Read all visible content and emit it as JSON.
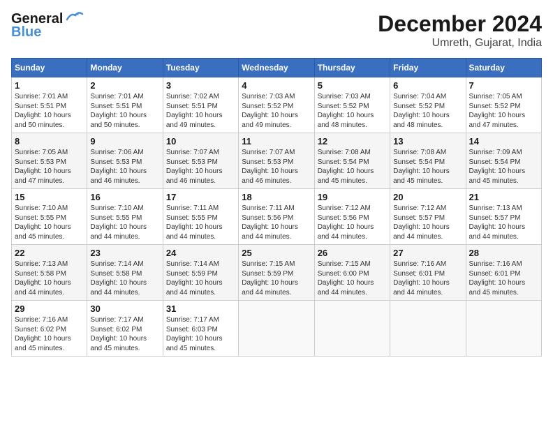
{
  "header": {
    "logo_general": "General",
    "logo_blue": "Blue",
    "month": "December 2024",
    "location": "Umreth, Gujarat, India"
  },
  "weekdays": [
    "Sunday",
    "Monday",
    "Tuesday",
    "Wednesday",
    "Thursday",
    "Friday",
    "Saturday"
  ],
  "weeks": [
    [
      {
        "day": "1",
        "sunrise": "7:01 AM",
        "sunset": "5:51 PM",
        "daylight": "10 hours and 50 minutes."
      },
      {
        "day": "2",
        "sunrise": "7:01 AM",
        "sunset": "5:51 PM",
        "daylight": "10 hours and 50 minutes."
      },
      {
        "day": "3",
        "sunrise": "7:02 AM",
        "sunset": "5:51 PM",
        "daylight": "10 hours and 49 minutes."
      },
      {
        "day": "4",
        "sunrise": "7:03 AM",
        "sunset": "5:52 PM",
        "daylight": "10 hours and 49 minutes."
      },
      {
        "day": "5",
        "sunrise": "7:03 AM",
        "sunset": "5:52 PM",
        "daylight": "10 hours and 48 minutes."
      },
      {
        "day": "6",
        "sunrise": "7:04 AM",
        "sunset": "5:52 PM",
        "daylight": "10 hours and 48 minutes."
      },
      {
        "day": "7",
        "sunrise": "7:05 AM",
        "sunset": "5:52 PM",
        "daylight": "10 hours and 47 minutes."
      }
    ],
    [
      {
        "day": "8",
        "sunrise": "7:05 AM",
        "sunset": "5:53 PM",
        "daylight": "10 hours and 47 minutes."
      },
      {
        "day": "9",
        "sunrise": "7:06 AM",
        "sunset": "5:53 PM",
        "daylight": "10 hours and 46 minutes."
      },
      {
        "day": "10",
        "sunrise": "7:07 AM",
        "sunset": "5:53 PM",
        "daylight": "10 hours and 46 minutes."
      },
      {
        "day": "11",
        "sunrise": "7:07 AM",
        "sunset": "5:53 PM",
        "daylight": "10 hours and 46 minutes."
      },
      {
        "day": "12",
        "sunrise": "7:08 AM",
        "sunset": "5:54 PM",
        "daylight": "10 hours and 45 minutes."
      },
      {
        "day": "13",
        "sunrise": "7:08 AM",
        "sunset": "5:54 PM",
        "daylight": "10 hours and 45 minutes."
      },
      {
        "day": "14",
        "sunrise": "7:09 AM",
        "sunset": "5:54 PM",
        "daylight": "10 hours and 45 minutes."
      }
    ],
    [
      {
        "day": "15",
        "sunrise": "7:10 AM",
        "sunset": "5:55 PM",
        "daylight": "10 hours and 45 minutes."
      },
      {
        "day": "16",
        "sunrise": "7:10 AM",
        "sunset": "5:55 PM",
        "daylight": "10 hours and 44 minutes."
      },
      {
        "day": "17",
        "sunrise": "7:11 AM",
        "sunset": "5:55 PM",
        "daylight": "10 hours and 44 minutes."
      },
      {
        "day": "18",
        "sunrise": "7:11 AM",
        "sunset": "5:56 PM",
        "daylight": "10 hours and 44 minutes."
      },
      {
        "day": "19",
        "sunrise": "7:12 AM",
        "sunset": "5:56 PM",
        "daylight": "10 hours and 44 minutes."
      },
      {
        "day": "20",
        "sunrise": "7:12 AM",
        "sunset": "5:57 PM",
        "daylight": "10 hours and 44 minutes."
      },
      {
        "day": "21",
        "sunrise": "7:13 AM",
        "sunset": "5:57 PM",
        "daylight": "10 hours and 44 minutes."
      }
    ],
    [
      {
        "day": "22",
        "sunrise": "7:13 AM",
        "sunset": "5:58 PM",
        "daylight": "10 hours and 44 minutes."
      },
      {
        "day": "23",
        "sunrise": "7:14 AM",
        "sunset": "5:58 PM",
        "daylight": "10 hours and 44 minutes."
      },
      {
        "day": "24",
        "sunrise": "7:14 AM",
        "sunset": "5:59 PM",
        "daylight": "10 hours and 44 minutes."
      },
      {
        "day": "25",
        "sunrise": "7:15 AM",
        "sunset": "5:59 PM",
        "daylight": "10 hours and 44 minutes."
      },
      {
        "day": "26",
        "sunrise": "7:15 AM",
        "sunset": "6:00 PM",
        "daylight": "10 hours and 44 minutes."
      },
      {
        "day": "27",
        "sunrise": "7:16 AM",
        "sunset": "6:01 PM",
        "daylight": "10 hours and 44 minutes."
      },
      {
        "day": "28",
        "sunrise": "7:16 AM",
        "sunset": "6:01 PM",
        "daylight": "10 hours and 45 minutes."
      }
    ],
    [
      {
        "day": "29",
        "sunrise": "7:16 AM",
        "sunset": "6:02 PM",
        "daylight": "10 hours and 45 minutes."
      },
      {
        "day": "30",
        "sunrise": "7:17 AM",
        "sunset": "6:02 PM",
        "daylight": "10 hours and 45 minutes."
      },
      {
        "day": "31",
        "sunrise": "7:17 AM",
        "sunset": "6:03 PM",
        "daylight": "10 hours and 45 minutes."
      },
      null,
      null,
      null,
      null
    ]
  ]
}
